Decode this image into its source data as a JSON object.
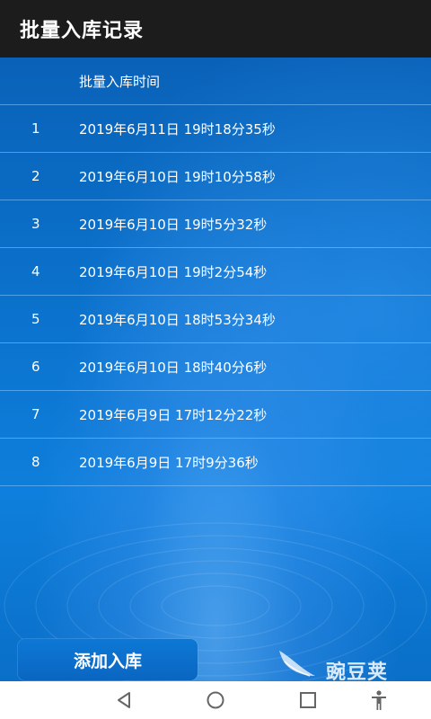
{
  "app_bar": {
    "title": "批量入库记录"
  },
  "table": {
    "time_header": "批量入库时间",
    "rows": [
      {
        "index": "1",
        "time": "2019年6月11日 19时18分35秒"
      },
      {
        "index": "2",
        "time": "2019年6月10日 19时10分58秒"
      },
      {
        "index": "3",
        "time": "2019年6月10日 19时5分32秒"
      },
      {
        "index": "4",
        "time": "2019年6月10日 19时2分54秒"
      },
      {
        "index": "5",
        "time": "2019年6月10日 18时53分34秒"
      },
      {
        "index": "6",
        "time": "2019年6月10日 18时40分6秒"
      },
      {
        "index": "7",
        "time": "2019年6月9日 17时12分22秒"
      },
      {
        "index": "8",
        "time": "2019年6月9日 17时9分36秒"
      }
    ]
  },
  "actions": {
    "add_button_label": "添加入库"
  },
  "watermark": {
    "text": "豌豆荚"
  },
  "nav_bar": {
    "icons": [
      "back-icon",
      "home-icon",
      "recents-icon",
      "accessibility-icon"
    ]
  },
  "colors": {
    "app_bar_bg": "#1c1c1c",
    "content_bg": "#0b74cf",
    "row_divider": "#8cc8ff",
    "text": "#ffffff"
  }
}
